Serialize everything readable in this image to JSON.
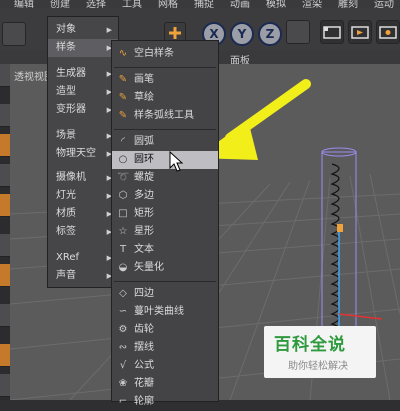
{
  "menubar": {
    "items": [
      "编辑",
      "创建",
      "选择",
      "工具",
      "网格",
      "捕捉",
      "动画",
      "模拟",
      "渲染",
      "雕刻",
      "运动"
    ]
  },
  "toolbar": {
    "axis_buttons": [
      "X",
      "Y",
      "Z"
    ]
  },
  "viewport": {
    "label": "透视视图",
    "panel_label": "面板"
  },
  "create_menu": {
    "items": [
      {
        "label": "对象",
        "submenu": true
      },
      {
        "label": "样条",
        "submenu": true,
        "selected": true
      },
      {
        "label": "生成器",
        "submenu": true
      },
      {
        "label": "造型",
        "submenu": true
      },
      {
        "label": "变形器",
        "submenu": true
      },
      {
        "label": "场景",
        "submenu": true
      },
      {
        "label": "物理天空",
        "submenu": true
      },
      {
        "label": "摄像机",
        "submenu": true
      },
      {
        "label": "灯光",
        "submenu": true
      },
      {
        "label": "材质",
        "submenu": true
      },
      {
        "label": "标签",
        "submenu": true
      },
      {
        "label": "XRef",
        "submenu": true
      },
      {
        "label": "声音",
        "submenu": true
      }
    ]
  },
  "spline_menu": {
    "items": [
      {
        "label": "空白样条",
        "icon": "empty-spline-icon",
        "glyph": "∿"
      },
      {
        "label": "画笔",
        "icon": "pen-icon",
        "glyph": "✎"
      },
      {
        "label": "草绘",
        "icon": "sketch-icon",
        "glyph": "✎"
      },
      {
        "label": "样条弧线工具",
        "icon": "arc-tool-icon",
        "glyph": "✎"
      },
      {
        "label": "圆弧",
        "icon": "arc-icon",
        "glyph": "◜"
      },
      {
        "label": "圆环",
        "icon": "circle-icon",
        "glyph": "○",
        "highlighted": true
      },
      {
        "label": "螺旋",
        "icon": "helix-icon",
        "glyph": "➰"
      },
      {
        "label": "多边",
        "icon": "polygon-icon",
        "glyph": "⬡"
      },
      {
        "label": "矩形",
        "icon": "rectangle-icon",
        "glyph": "□"
      },
      {
        "label": "星形",
        "icon": "star-icon",
        "glyph": "☆"
      },
      {
        "label": "文本",
        "icon": "text-icon",
        "glyph": "T"
      },
      {
        "label": "矢量化",
        "icon": "vectorize-icon",
        "glyph": "◒"
      },
      {
        "label": "四边",
        "icon": "four-side-icon",
        "glyph": "◇"
      },
      {
        "label": "蔓叶类曲线",
        "icon": "cissoid-icon",
        "glyph": "∽"
      },
      {
        "label": "齿轮",
        "icon": "gear-icon",
        "glyph": "⚙"
      },
      {
        "label": "摆线",
        "icon": "cycloid-icon",
        "glyph": "∾"
      },
      {
        "label": "公式",
        "icon": "formula-icon",
        "glyph": "√"
      },
      {
        "label": "花瓣",
        "icon": "flower-icon",
        "glyph": "❀"
      },
      {
        "label": "轮廓",
        "icon": "profile-icon",
        "glyph": "⌐"
      }
    ]
  },
  "watermark": {
    "title": "百科全说",
    "subtitle": "助你轻松解决"
  },
  "colors": {
    "arrow": "#f2ee1a",
    "spring": "#9b8cf0",
    "brand_green": "#2e9a3d"
  }
}
